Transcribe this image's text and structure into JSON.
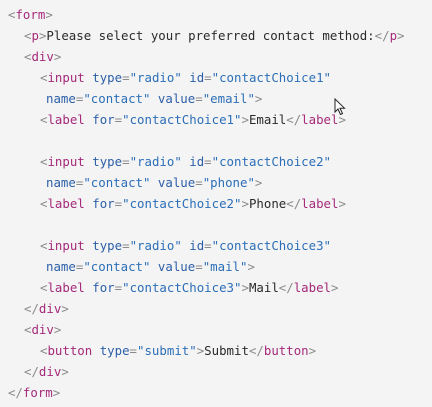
{
  "code": {
    "lines": [
      {
        "indent": 0,
        "tokens": [
          {
            "t": "punct",
            "v": "<"
          },
          {
            "t": "tag",
            "v": "form"
          },
          {
            "t": "punct",
            "v": ">"
          }
        ]
      },
      {
        "indent": 1,
        "tokens": [
          {
            "t": "punct",
            "v": "<"
          },
          {
            "t": "tag",
            "v": "p"
          },
          {
            "t": "punct",
            "v": ">"
          },
          {
            "t": "text",
            "v": "Please select your preferred contact method:"
          },
          {
            "t": "punct",
            "v": "</"
          },
          {
            "t": "tag",
            "v": "p"
          },
          {
            "t": "punct",
            "v": ">"
          }
        ]
      },
      {
        "indent": 1,
        "tokens": [
          {
            "t": "punct",
            "v": "<"
          },
          {
            "t": "tag",
            "v": "div"
          },
          {
            "t": "punct",
            "v": ">"
          }
        ]
      },
      {
        "indent": 2,
        "tokens": [
          {
            "t": "punct",
            "v": "<"
          },
          {
            "t": "tag",
            "v": "input"
          },
          {
            "t": "text",
            "v": " "
          },
          {
            "t": "attr",
            "v": "type"
          },
          {
            "t": "punct",
            "v": "="
          },
          {
            "t": "str",
            "v": "\"radio\""
          },
          {
            "t": "text",
            "v": " "
          },
          {
            "t": "attr",
            "v": "id"
          },
          {
            "t": "punct",
            "v": "="
          },
          {
            "t": "str",
            "v": "\"contactChoice1\""
          }
        ]
      },
      {
        "indent": 3,
        "tokens": [
          {
            "t": "attr",
            "v": "name"
          },
          {
            "t": "punct",
            "v": "="
          },
          {
            "t": "str",
            "v": "\"contact\""
          },
          {
            "t": "text",
            "v": " "
          },
          {
            "t": "attr",
            "v": "value"
          },
          {
            "t": "punct",
            "v": "="
          },
          {
            "t": "str",
            "v": "\"email\""
          },
          {
            "t": "punct",
            "v": ">"
          }
        ]
      },
      {
        "indent": 2,
        "tokens": [
          {
            "t": "punct",
            "v": "<"
          },
          {
            "t": "tag",
            "v": "label"
          },
          {
            "t": "text",
            "v": " "
          },
          {
            "t": "attr",
            "v": "for"
          },
          {
            "t": "punct",
            "v": "="
          },
          {
            "t": "str",
            "v": "\"contactChoice1\""
          },
          {
            "t": "punct",
            "v": ">"
          },
          {
            "t": "text",
            "v": "Email"
          },
          {
            "t": "punct",
            "v": "</"
          },
          {
            "t": "tag",
            "v": "label"
          },
          {
            "t": "punct",
            "v": ">"
          }
        ]
      },
      {
        "indent": 0,
        "tokens": []
      },
      {
        "indent": 2,
        "tokens": [
          {
            "t": "punct",
            "v": "<"
          },
          {
            "t": "tag",
            "v": "input"
          },
          {
            "t": "text",
            "v": " "
          },
          {
            "t": "attr",
            "v": "type"
          },
          {
            "t": "punct",
            "v": "="
          },
          {
            "t": "str",
            "v": "\"radio\""
          },
          {
            "t": "text",
            "v": " "
          },
          {
            "t": "attr",
            "v": "id"
          },
          {
            "t": "punct",
            "v": "="
          },
          {
            "t": "str",
            "v": "\"contactChoice2\""
          }
        ]
      },
      {
        "indent": 3,
        "tokens": [
          {
            "t": "attr",
            "v": "name"
          },
          {
            "t": "punct",
            "v": "="
          },
          {
            "t": "str",
            "v": "\"contact\""
          },
          {
            "t": "text",
            "v": " "
          },
          {
            "t": "attr",
            "v": "value"
          },
          {
            "t": "punct",
            "v": "="
          },
          {
            "t": "str",
            "v": "\"phone\""
          },
          {
            "t": "punct",
            "v": ">"
          }
        ]
      },
      {
        "indent": 2,
        "tokens": [
          {
            "t": "punct",
            "v": "<"
          },
          {
            "t": "tag",
            "v": "label"
          },
          {
            "t": "text",
            "v": " "
          },
          {
            "t": "attr",
            "v": "for"
          },
          {
            "t": "punct",
            "v": "="
          },
          {
            "t": "str",
            "v": "\"contactChoice2\""
          },
          {
            "t": "punct",
            "v": ">"
          },
          {
            "t": "text",
            "v": "Phone"
          },
          {
            "t": "punct",
            "v": "</"
          },
          {
            "t": "tag",
            "v": "label"
          },
          {
            "t": "punct",
            "v": ">"
          }
        ]
      },
      {
        "indent": 0,
        "tokens": []
      },
      {
        "indent": 2,
        "tokens": [
          {
            "t": "punct",
            "v": "<"
          },
          {
            "t": "tag",
            "v": "input"
          },
          {
            "t": "text",
            "v": " "
          },
          {
            "t": "attr",
            "v": "type"
          },
          {
            "t": "punct",
            "v": "="
          },
          {
            "t": "str",
            "v": "\"radio\""
          },
          {
            "t": "text",
            "v": " "
          },
          {
            "t": "attr",
            "v": "id"
          },
          {
            "t": "punct",
            "v": "="
          },
          {
            "t": "str",
            "v": "\"contactChoice3\""
          }
        ]
      },
      {
        "indent": 3,
        "tokens": [
          {
            "t": "attr",
            "v": "name"
          },
          {
            "t": "punct",
            "v": "="
          },
          {
            "t": "str",
            "v": "\"contact\""
          },
          {
            "t": "text",
            "v": " "
          },
          {
            "t": "attr",
            "v": "value"
          },
          {
            "t": "punct",
            "v": "="
          },
          {
            "t": "str",
            "v": "\"mail\""
          },
          {
            "t": "punct",
            "v": ">"
          }
        ]
      },
      {
        "indent": 2,
        "tokens": [
          {
            "t": "punct",
            "v": "<"
          },
          {
            "t": "tag",
            "v": "label"
          },
          {
            "t": "text",
            "v": " "
          },
          {
            "t": "attr",
            "v": "for"
          },
          {
            "t": "punct",
            "v": "="
          },
          {
            "t": "str",
            "v": "\"contactChoice3\""
          },
          {
            "t": "punct",
            "v": ">"
          },
          {
            "t": "text",
            "v": "Mail"
          },
          {
            "t": "punct",
            "v": "</"
          },
          {
            "t": "tag",
            "v": "label"
          },
          {
            "t": "punct",
            "v": ">"
          }
        ]
      },
      {
        "indent": 1,
        "tokens": [
          {
            "t": "punct",
            "v": "</"
          },
          {
            "t": "tag",
            "v": "div"
          },
          {
            "t": "punct",
            "v": ">"
          }
        ]
      },
      {
        "indent": 1,
        "tokens": [
          {
            "t": "punct",
            "v": "<"
          },
          {
            "t": "tag",
            "v": "div"
          },
          {
            "t": "punct",
            "v": ">"
          }
        ]
      },
      {
        "indent": 2,
        "tokens": [
          {
            "t": "punct",
            "v": "<"
          },
          {
            "t": "tag",
            "v": "button"
          },
          {
            "t": "text",
            "v": " "
          },
          {
            "t": "attr",
            "v": "type"
          },
          {
            "t": "punct",
            "v": "="
          },
          {
            "t": "str",
            "v": "\"submit\""
          },
          {
            "t": "punct",
            "v": ">"
          },
          {
            "t": "text",
            "v": "Submit"
          },
          {
            "t": "punct",
            "v": "</"
          },
          {
            "t": "tag",
            "v": "button"
          },
          {
            "t": "punct",
            "v": ">"
          }
        ]
      },
      {
        "indent": 1,
        "tokens": [
          {
            "t": "punct",
            "v": "</"
          },
          {
            "t": "tag",
            "v": "div"
          },
          {
            "t": "punct",
            "v": ">"
          }
        ]
      },
      {
        "indent": 0,
        "tokens": [
          {
            "t": "punct",
            "v": "</"
          },
          {
            "t": "tag",
            "v": "form"
          },
          {
            "t": "punct",
            "v": ">"
          }
        ]
      }
    ]
  },
  "cursor": {
    "icon": "mouse-pointer-icon"
  },
  "colors": {
    "background": "#f4f4f4",
    "tag": "#a52a7a",
    "attribute": "#2c5fa8",
    "string": "#2c6fb8",
    "punctuation": "#8a8a8a",
    "text": "#2a2a2a"
  }
}
